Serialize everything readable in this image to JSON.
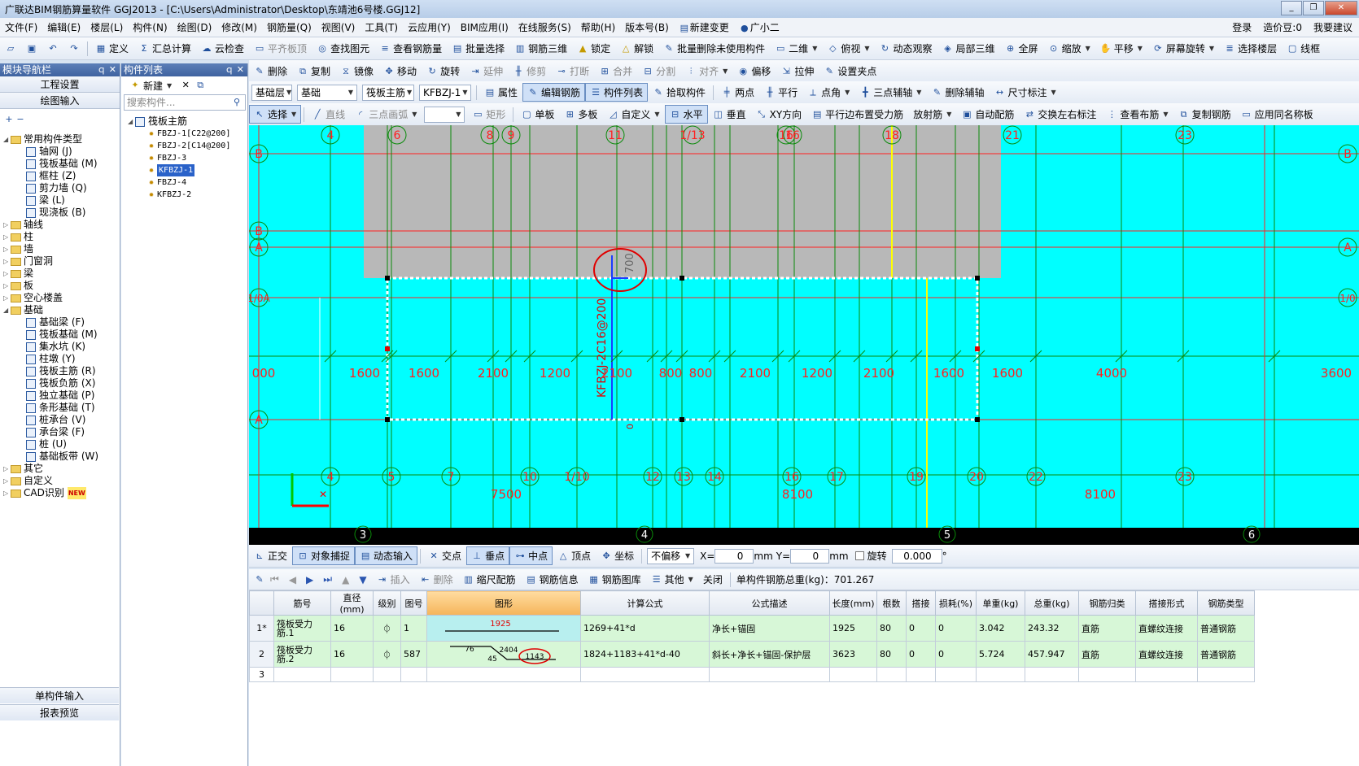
{
  "title": "广联达BIM钢筋算量软件 GGJ2013 - [C:\\Users\\Administrator\\Desktop\\东靖池6号楼.GGJ12]",
  "window_buttons": [
    "_",
    "❐",
    "✕"
  ],
  "menu": [
    "文件(F)",
    "编辑(E)",
    "楼层(L)",
    "构件(N)",
    "绘图(D)",
    "修改(M)",
    "钢筋量(Q)",
    "视图(V)",
    "工具(T)",
    "云应用(Y)",
    "BIM应用(I)",
    "在线服务(S)",
    "帮助(H)",
    "版本号(B)",
    "新建变更",
    "广小二"
  ],
  "menu_right": [
    "登录",
    "造价豆:0",
    "我要建议"
  ],
  "toolbar1": [
    "定义",
    "汇总计算",
    "云检查",
    "平齐板顶",
    "查找图元",
    "查看钢筋量",
    "批量选择",
    "钢筋三维",
    "锁定",
    "解锁",
    "批量删除未使用构件",
    "二维",
    "俯视",
    "动态观察",
    "局部三维",
    "全屏",
    "缩放",
    "平移",
    "屏幕旋转",
    "选择楼层",
    "线框"
  ],
  "toolbar2": [
    "删除",
    "复制",
    "镜像",
    "移动",
    "旋转",
    "延伸",
    "修剪",
    "打断",
    "合并",
    "分割",
    "对齐",
    "偏移",
    "拉伸",
    "设置夹点"
  ],
  "toolbar3": {
    "floor": "基础层",
    "category": "基础",
    "type": "筏板主筋",
    "component": "KFBZJ-1",
    "buttons": [
      "属性",
      "编辑钢筋",
      "构件列表",
      "拾取构件",
      "两点",
      "平行",
      "点角",
      "三点辅轴",
      "删除辅轴",
      "尺寸标注"
    ]
  },
  "toolbar4": [
    "选择",
    "直线",
    "三点画弧",
    "矩形",
    "单板",
    "多板",
    "自定义",
    "水平",
    "垂直",
    "XY方向",
    "平行边布置受力筋",
    "放射筋",
    "自动配筋",
    "交换左右标注",
    "查看布筋",
    "复制钢筋",
    "应用同名称板"
  ],
  "left_panel": {
    "header": "模块导航栏",
    "header_ctrl": "ｑ ✕",
    "nav_buttons": [
      "工程设置",
      "绘图输入"
    ],
    "tree": [
      {
        "label": "常用构件类型",
        "level": 0,
        "type": "folder",
        "exp": "◢"
      },
      {
        "label": "轴网 (J)",
        "level": 1,
        "type": "item"
      },
      {
        "label": "筏板基础 (M)",
        "level": 1,
        "type": "item"
      },
      {
        "label": "框柱 (Z)",
        "level": 1,
        "type": "item"
      },
      {
        "label": "剪力墙 (Q)",
        "level": 1,
        "type": "item"
      },
      {
        "label": "梁 (L)",
        "level": 1,
        "type": "item"
      },
      {
        "label": "现浇板 (B)",
        "level": 1,
        "type": "item"
      },
      {
        "label": "轴线",
        "level": 0,
        "type": "folder",
        "exp": "▷"
      },
      {
        "label": "柱",
        "level": 0,
        "type": "folder",
        "exp": "▷"
      },
      {
        "label": "墙",
        "level": 0,
        "type": "folder",
        "exp": "▷"
      },
      {
        "label": "门窗洞",
        "level": 0,
        "type": "folder",
        "exp": "▷"
      },
      {
        "label": "梁",
        "level": 0,
        "type": "folder",
        "exp": "▷"
      },
      {
        "label": "板",
        "level": 0,
        "type": "folder",
        "exp": "▷"
      },
      {
        "label": "空心楼盖",
        "level": 0,
        "type": "folder",
        "exp": "▷"
      },
      {
        "label": "基础",
        "level": 0,
        "type": "folder",
        "exp": "◢"
      },
      {
        "label": "基础梁 (F)",
        "level": 1,
        "type": "item"
      },
      {
        "label": "筏板基础 (M)",
        "level": 1,
        "type": "item"
      },
      {
        "label": "集水坑 (K)",
        "level": 1,
        "type": "item"
      },
      {
        "label": "柱墩 (Y)",
        "level": 1,
        "type": "item"
      },
      {
        "label": "筏板主筋 (R)",
        "level": 1,
        "type": "item"
      },
      {
        "label": "筏板负筋 (X)",
        "level": 1,
        "type": "item"
      },
      {
        "label": "独立基础 (P)",
        "level": 1,
        "type": "item"
      },
      {
        "label": "条形基础 (T)",
        "level": 1,
        "type": "item"
      },
      {
        "label": "桩承台 (V)",
        "level": 1,
        "type": "item"
      },
      {
        "label": "承台梁 (F)",
        "level": 1,
        "type": "item"
      },
      {
        "label": "桩 (U)",
        "level": 1,
        "type": "item"
      },
      {
        "label": "基础板带 (W)",
        "level": 1,
        "type": "item"
      },
      {
        "label": "其它",
        "level": 0,
        "type": "folder",
        "exp": "▷"
      },
      {
        "label": "自定义",
        "level": 0,
        "type": "folder",
        "exp": "▷"
      },
      {
        "label": "CAD识别",
        "level": 0,
        "type": "folder",
        "exp": "▷"
      }
    ],
    "cad_badge": "NEW",
    "bottom_buttons": [
      "单构件输入",
      "报表预览"
    ]
  },
  "mid_panel": {
    "header": "构件列表",
    "header_ctrl": "ｑ ✕",
    "new_button": "新建",
    "search_placeholder": "搜索构件...",
    "root": "筏板主筋",
    "items": [
      "FBZJ-1[C22@200]",
      "FBZJ-2[C14@200]",
      "FBZJ-3",
      "KFBZJ-1",
      "FBZJ-4",
      "KFBZJ-2"
    ],
    "selected_index": 3
  },
  "canvas": {
    "top_axes": [
      "4",
      "6",
      "8",
      "9",
      "11",
      "1/13",
      "16",
      "16",
      "18",
      "21",
      "23"
    ],
    "bottom_axes": [
      "4",
      "5",
      "7",
      "10",
      "1/10",
      "12",
      "13",
      "14",
      "16",
      "17",
      "19",
      "20",
      "22",
      "23"
    ],
    "bottom_axes2": [
      "3",
      "4",
      "5",
      "6"
    ],
    "left_axes": [
      "B",
      "B",
      "A",
      "1/0A",
      "A"
    ],
    "right_axes": [
      "B",
      "A",
      "1/0"
    ],
    "dims_mid": [
      "000",
      "1600",
      "1600",
      "2100",
      "1200",
      "2100",
      "800",
      "800",
      "2100",
      "1200",
      "2100",
      "1600",
      "1600",
      "4000",
      "3600"
    ],
    "dims_bottom": [
      "7500",
      "8100",
      "8100"
    ],
    "rebar_label": "KFBZJ-2C16@200",
    "dim_700": "700",
    "zero": "0",
    "axis_x_mark": "✕"
  },
  "bottom_toolbar": {
    "buttons": [
      "正交",
      "对象捕捉",
      "动态输入",
      "交点",
      "垂点",
      "中点",
      "顶点",
      "坐标"
    ],
    "offset": "不偏移",
    "x_label": "X=",
    "x_value": "0",
    "x_unit": "mm",
    "y_label": "Y=",
    "y_value": "0",
    "y_unit": "mm",
    "rotate_label": "旋转",
    "rotate_value": "0.000",
    "rotate_unit": "°"
  },
  "grid_toolbar": {
    "buttons": [
      "插入",
      "删除",
      "缩尺配筋",
      "钢筋信息",
      "钢筋图库",
      "其他",
      "关闭"
    ],
    "total": "单构件钢筋总重(kg)：701.267"
  },
  "table": {
    "headers": [
      "筋号",
      "直径(mm)",
      "级别",
      "图号",
      "图形",
      "计算公式",
      "公式描述",
      "长度(mm)",
      "根数",
      "搭接",
      "损耗(%)",
      "单重(kg)",
      "总重(kg)",
      "钢筋归类",
      "搭接形式",
      "钢筋类型"
    ],
    "rows": [
      {
        "row": "1*",
        "name": "筏板受力筋.1",
        "dia": "16",
        "grade": "⏀",
        "fig": "1",
        "shape_val": "1925",
        "formula": "1269+41*d",
        "desc": "净长+锚固",
        "len": "1925",
        "count": "80",
        "lap": "0",
        "loss": "0",
        "unit_w": "3.042",
        "total_w": "243.32",
        "cat": "直筋",
        "lap_form": "直螺纹连接",
        "rebar_type": "普通钢筋"
      },
      {
        "row": "2",
        "name": "筏板受力筋.2",
        "dia": "16",
        "grade": "⏀",
        "fig": "587",
        "shape_vals": [
          "76",
          "2404",
          "45",
          "1143"
        ],
        "formula": "1824+1183+41*d-40",
        "desc": "斜长+净长+锚固-保护层",
        "len": "3623",
        "count": "80",
        "lap": "0",
        "loss": "0",
        "unit_w": "5.724",
        "total_w": "457.947",
        "cat": "直筋",
        "lap_form": "直螺纹连接",
        "rebar_type": "普通钢筋"
      }
    ],
    "empty_row": "3"
  },
  "colors": {
    "canvas": "#00ffff",
    "axis_red": "#ff2020",
    "grid_green": "#0a8a0a",
    "slab_gray": "#b8b8b8"
  }
}
